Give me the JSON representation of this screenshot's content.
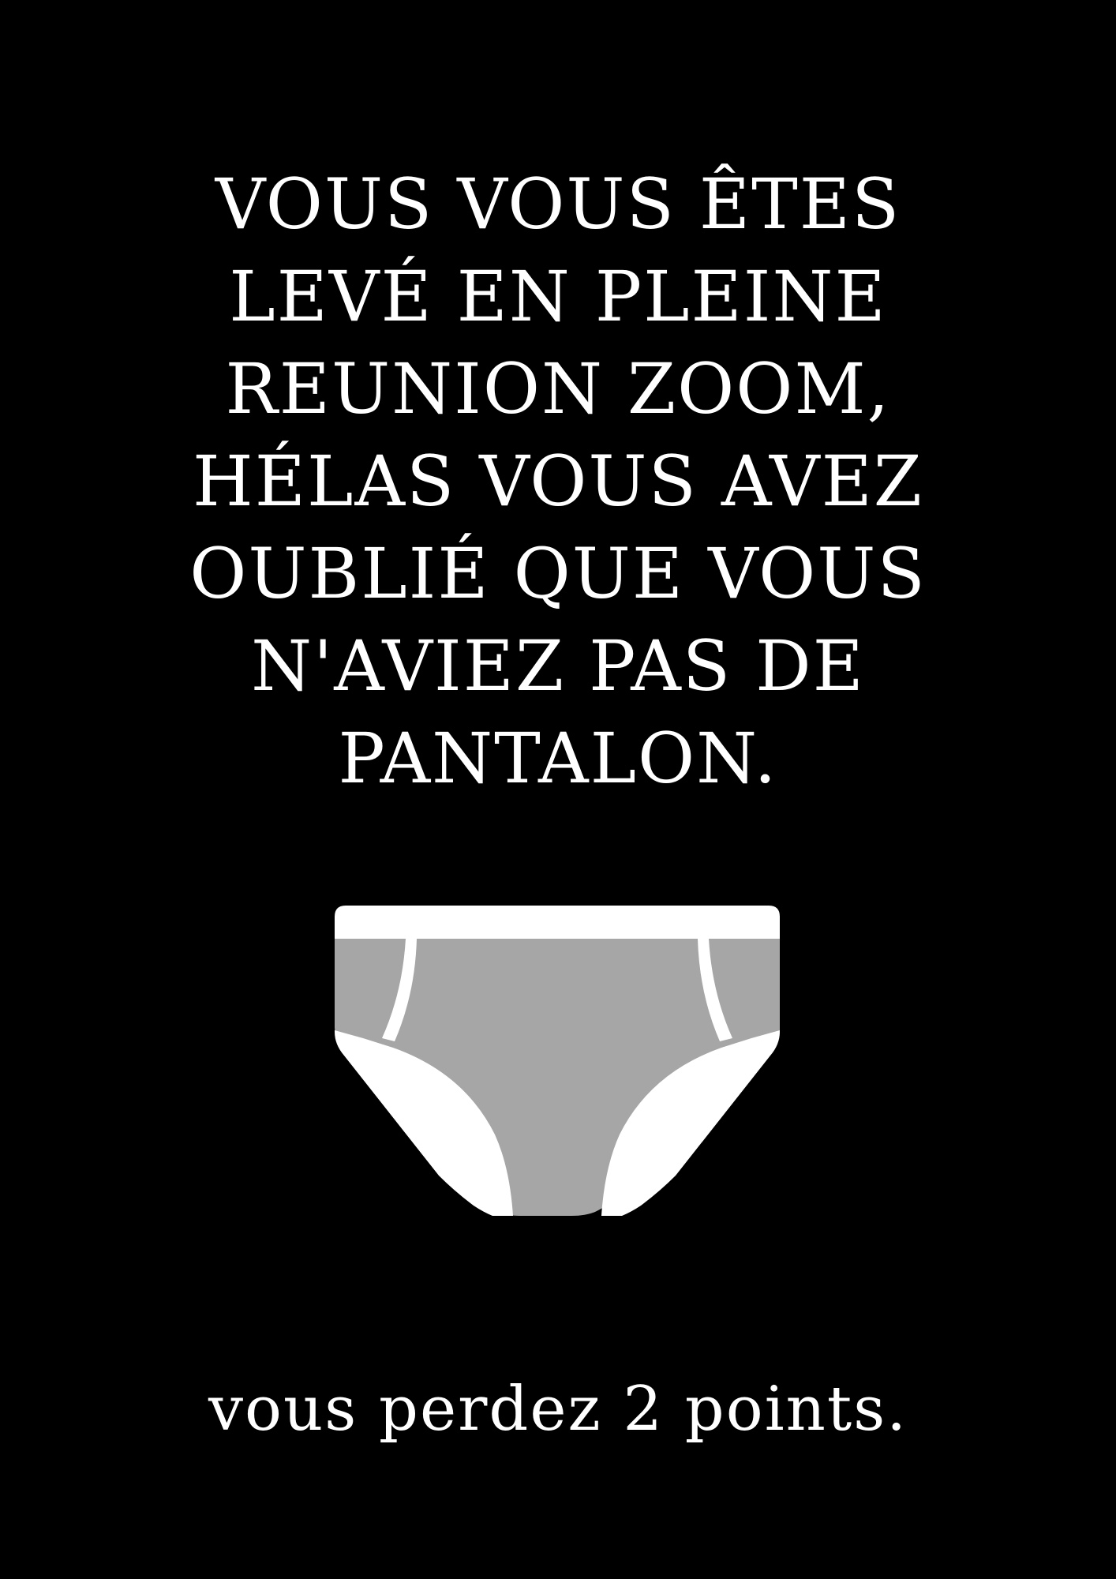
{
  "card": {
    "headline_lines": [
      "VOUS VOUS ÊTES",
      "LEVÉ EN PLEINE",
      "REUNION ZOOM,",
      "HÉLAS VOUS AVEZ",
      "OUBLIÉ QUE VOUS",
      "N'AVIEZ PAS DE",
      "PANTALON."
    ],
    "illustration_icon": "underwear-briefs-icon",
    "footer": "vous perdez 2 points."
  },
  "colors": {
    "background": "#000000",
    "text": "#ffffff",
    "briefs_white": "#ffffff",
    "briefs_gray": "#a6a6a6"
  }
}
